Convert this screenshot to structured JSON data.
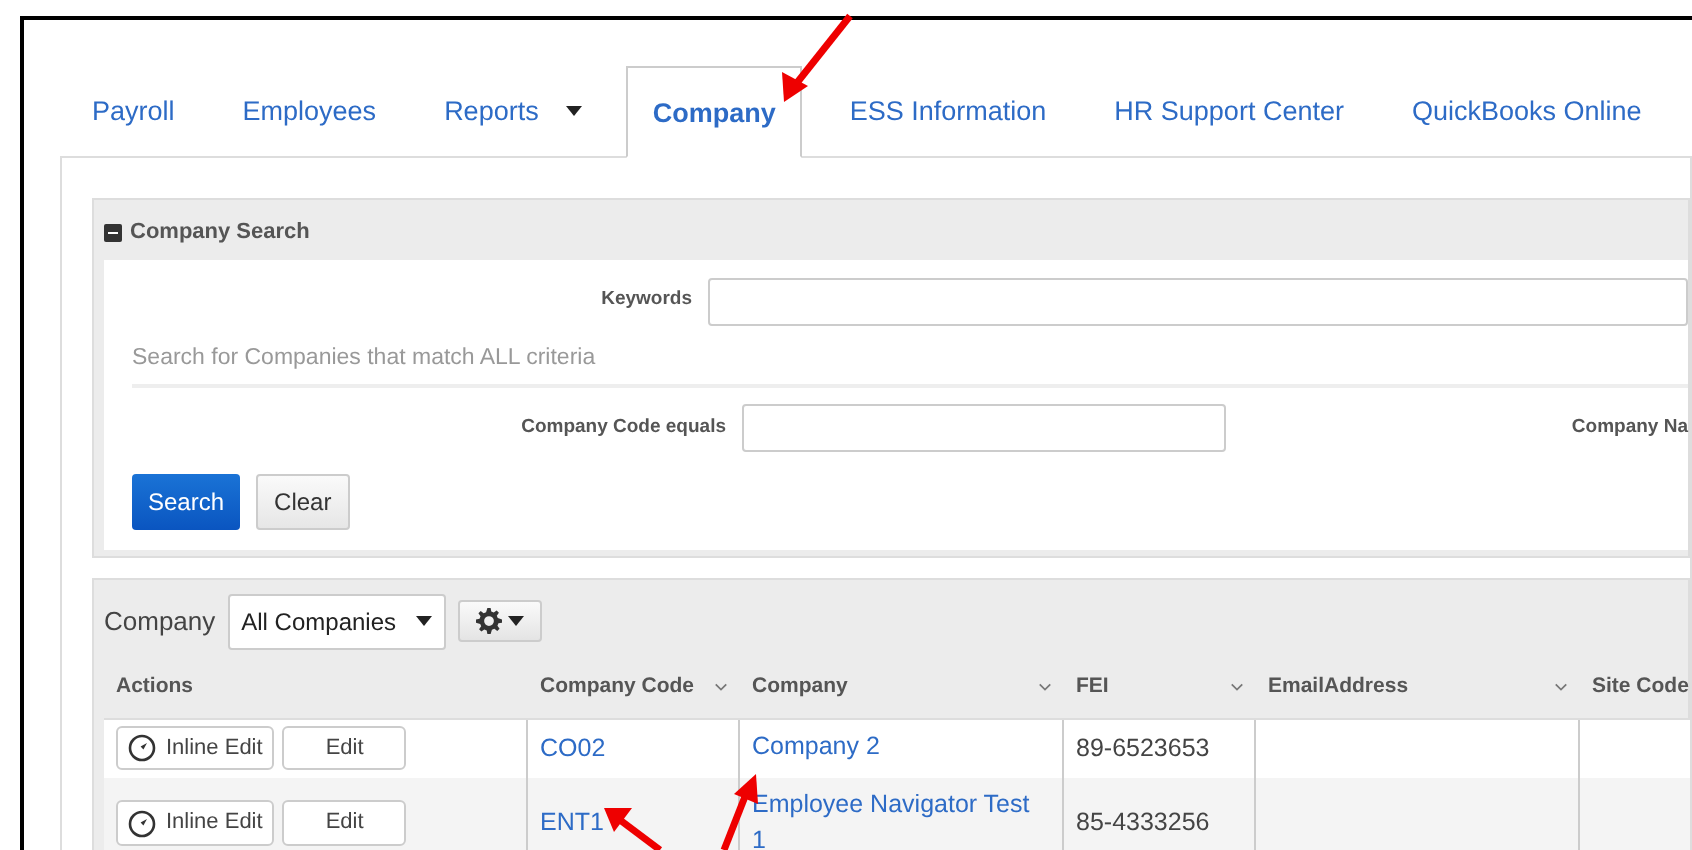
{
  "tabs": [
    {
      "label": "Payroll",
      "kind": "link",
      "selected": false
    },
    {
      "label": "Employees",
      "kind": "link",
      "selected": false
    },
    {
      "label": "Reports",
      "kind": "dropdown",
      "selected": false
    },
    {
      "label": "Company",
      "kind": "link",
      "selected": true
    },
    {
      "label": "ESS Information",
      "kind": "link",
      "selected": false
    },
    {
      "label": "HR Support Center",
      "kind": "link",
      "selected": false
    },
    {
      "label": "QuickBooks Online",
      "kind": "link",
      "selected": false
    }
  ],
  "search_panel": {
    "title": "Company Search",
    "expanded": true,
    "keywords_field": {
      "label": "Keywords"
    },
    "hint": "Search for Companies that match ALL criteria",
    "code_field": {
      "label": "Company Code equals"
    },
    "name_field": {
      "label": "Company Na"
    },
    "buttons": [
      {
        "label": "Search",
        "kind": "primary"
      },
      {
        "label": "Clear",
        "kind": "secondary"
      }
    ]
  },
  "grid": {
    "filter_label": "Company",
    "filter_value": "All Companies",
    "columns": [
      {
        "label": "Actions",
        "sortable": false
      },
      {
        "label": "Company Code",
        "sortable": true
      },
      {
        "label": "Company",
        "sortable": true
      },
      {
        "label": "FEI",
        "sortable": true
      },
      {
        "label": "EmailAddress",
        "sortable": true
      },
      {
        "label": "Site Code",
        "sortable": false
      }
    ],
    "rows": [
      {
        "actions": [
          "Inline Edit",
          "Edit"
        ],
        "code": "CO02",
        "company": "Company 2",
        "fei": "89-6523653"
      },
      {
        "actions": [
          "Inline Edit",
          "Edit"
        ],
        "code": "ENT1",
        "company": "Employee Navigator Test 1",
        "fei": "85-4333256"
      }
    ]
  }
}
